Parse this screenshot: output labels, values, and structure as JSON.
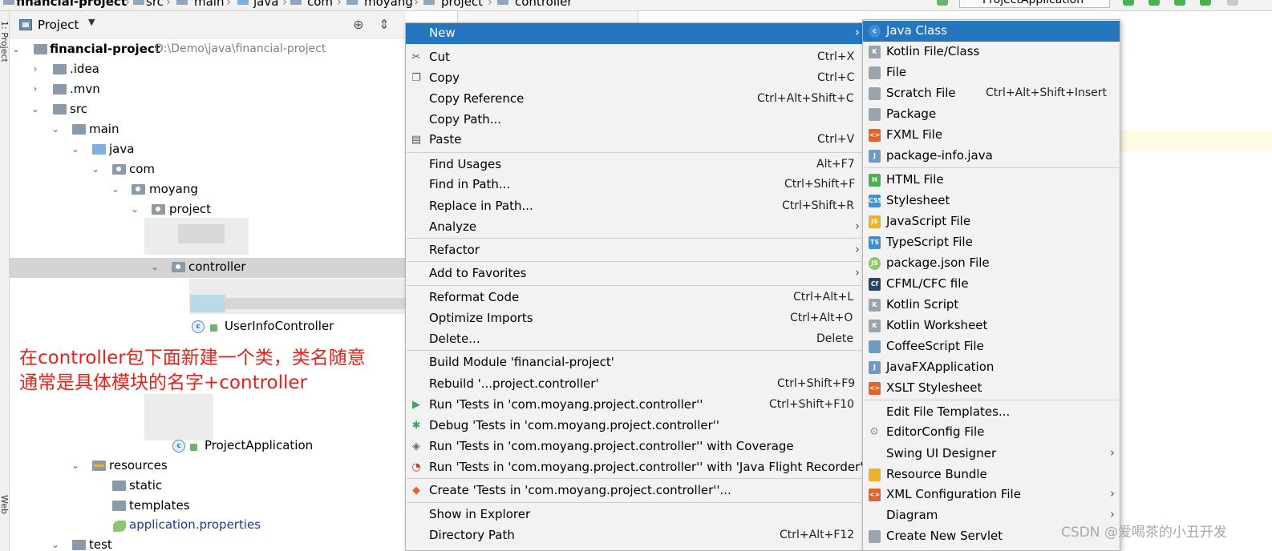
{
  "breadcrumb": {
    "items": [
      "financial-project",
      "src",
      "main",
      "java",
      "com",
      "moyang",
      "project",
      "controller"
    ],
    "run_config": "ProjectApplication"
  },
  "left_strip": {
    "project_tab": "1: Project",
    "web_tab": "Web"
  },
  "project_panel": {
    "title": "Project",
    "tree": [
      {
        "label": "financial-project",
        "path": "D:\\Demo\\java\\financial-project"
      },
      {
        "label": ".idea"
      },
      {
        "label": ".mvn"
      },
      {
        "label": "src"
      },
      {
        "label": "main"
      },
      {
        "label": "java"
      },
      {
        "label": "com"
      },
      {
        "label": "moyang"
      },
      {
        "label": "project"
      },
      {
        "label": "controller"
      },
      {
        "label": "UserInfoController"
      },
      {
        "label": "ProjectApplication"
      },
      {
        "label": "resources"
      },
      {
        "label": "static"
      },
      {
        "label": "templates"
      },
      {
        "label": "application.properties"
      },
      {
        "label": "test"
      }
    ]
  },
  "annotation": {
    "line1": "在controller包下面新建一个类，类名随意",
    "line2": "通常是具体模块的名字+controller",
    "color": "#e4231b"
  },
  "context_menu": {
    "items": [
      {
        "label": "New",
        "shortcut": ""
      },
      {
        "label": "Cut",
        "shortcut": "Ctrl+X"
      },
      {
        "label": "Copy",
        "shortcut": "Ctrl+C"
      },
      {
        "label": "Copy Reference",
        "shortcut": "Ctrl+Alt+Shift+C"
      },
      {
        "label": "Copy Path...",
        "shortcut": ""
      },
      {
        "label": "Paste",
        "shortcut": "Ctrl+V"
      },
      {
        "label": "Find Usages",
        "shortcut": "Alt+F7"
      },
      {
        "label": "Find in Path...",
        "shortcut": "Ctrl+Shift+F"
      },
      {
        "label": "Replace in Path...",
        "shortcut": "Ctrl+Shift+R"
      },
      {
        "label": "Analyze",
        "shortcut": ""
      },
      {
        "label": "Refactor",
        "shortcut": ""
      },
      {
        "label": "Add to Favorites",
        "shortcut": ""
      },
      {
        "label": "Reformat Code",
        "shortcut": "Ctrl+Alt+L"
      },
      {
        "label": "Optimize Imports",
        "shortcut": "Ctrl+Alt+O"
      },
      {
        "label": "Delete...",
        "shortcut": "Delete"
      },
      {
        "label": "Build Module 'financial-project'",
        "shortcut": ""
      },
      {
        "label": "Rebuild '...project.controller'",
        "shortcut": "Ctrl+Shift+F9"
      },
      {
        "label": "Run 'Tests in 'com.moyang.project.controller''",
        "shortcut": "Ctrl+Shift+F10"
      },
      {
        "label": "Debug 'Tests in 'com.moyang.project.controller''",
        "shortcut": ""
      },
      {
        "label": "Run 'Tests in 'com.moyang.project.controller'' with Coverage",
        "shortcut": ""
      },
      {
        "label": "Run 'Tests in 'com.moyang.project.controller'' with 'Java Flight Recorder'",
        "shortcut": ""
      },
      {
        "label": "Create 'Tests in 'com.moyang.project.controller''...",
        "shortcut": ""
      },
      {
        "label": "Show in Explorer",
        "shortcut": ""
      },
      {
        "label": "Directory Path",
        "shortcut": "Ctrl+Alt+F12"
      }
    ]
  },
  "new_submenu": {
    "items": [
      {
        "label": "Java Class",
        "shortcut": ""
      },
      {
        "label": "Kotlin File/Class",
        "shortcut": ""
      },
      {
        "label": "File",
        "shortcut": ""
      },
      {
        "label": "Scratch File",
        "shortcut": "Ctrl+Alt+Shift+Insert"
      },
      {
        "label": "Package",
        "shortcut": ""
      },
      {
        "label": "FXML File",
        "shortcut": ""
      },
      {
        "label": "package-info.java",
        "shortcut": ""
      },
      {
        "label": "HTML File",
        "shortcut": ""
      },
      {
        "label": "Stylesheet",
        "shortcut": ""
      },
      {
        "label": "JavaScript File",
        "shortcut": ""
      },
      {
        "label": "TypeScript File",
        "shortcut": ""
      },
      {
        "label": "package.json File",
        "shortcut": ""
      },
      {
        "label": "CFML/CFC file",
        "shortcut": ""
      },
      {
        "label": "Kotlin Script",
        "shortcut": ""
      },
      {
        "label": "Kotlin Worksheet",
        "shortcut": ""
      },
      {
        "label": "CoffeeScript File",
        "shortcut": ""
      },
      {
        "label": "JavaFXApplication",
        "shortcut": ""
      },
      {
        "label": "XSLT Stylesheet",
        "shortcut": ""
      },
      {
        "label": "Edit File Templates...",
        "shortcut": ""
      },
      {
        "label": "EditorConfig File",
        "shortcut": ""
      },
      {
        "label": "Swing UI Designer",
        "shortcut": ""
      },
      {
        "label": "Resource Bundle",
        "shortcut": ""
      },
      {
        "label": "XML Configuration File",
        "shortcut": ""
      },
      {
        "label": "Diagram",
        "shortcut": ""
      },
      {
        "label": "Create New Servlet",
        "shortcut": ""
      }
    ]
  },
  "watermark": "CSDN @爱喝茶的小丑开发",
  "colors": {
    "menu_bg": "#f2f2f2",
    "highlight": "#2675bf",
    "selection": "#d4d4d4",
    "annotation_red": "#e4231b"
  }
}
